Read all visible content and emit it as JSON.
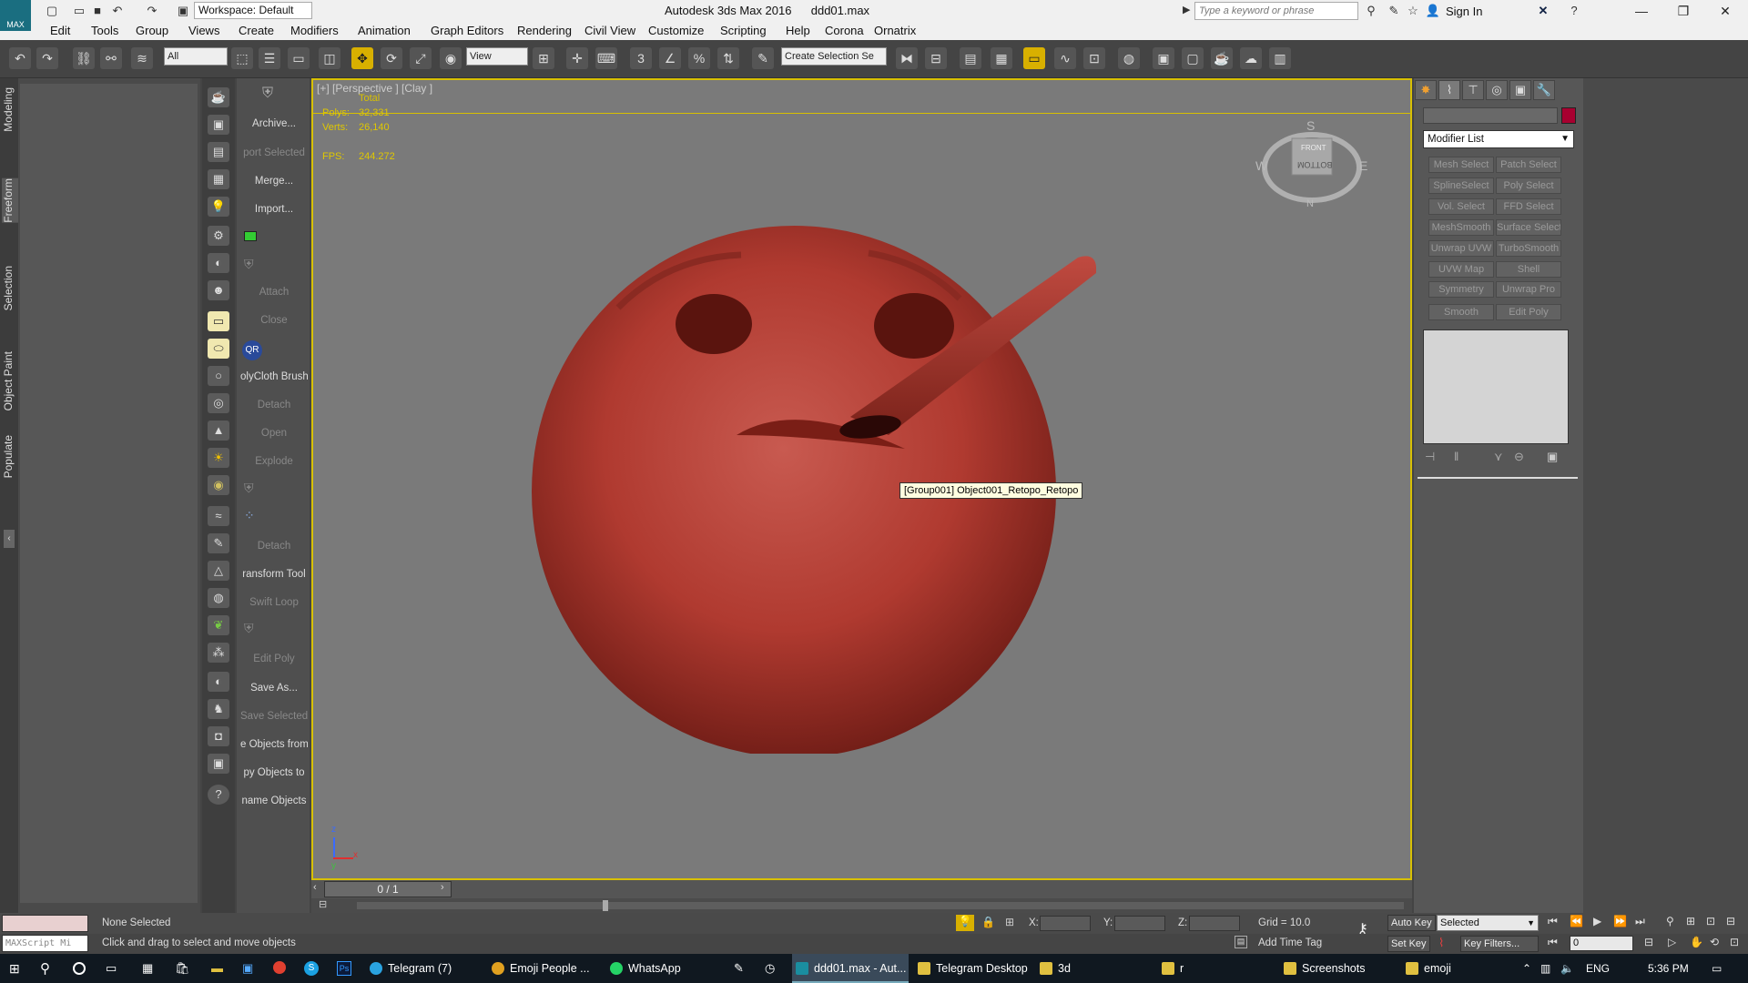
{
  "app": {
    "title": "Autodesk 3ds Max 2016",
    "file": "ddd01.max",
    "logo_text": "MAX",
    "workspace": "Workspace: Default",
    "search_placeholder": "Type a keyword or phrase",
    "sign_in": "Sign In"
  },
  "menubar": [
    "Edit",
    "Tools",
    "Group",
    "Views",
    "Create",
    "Modifiers",
    "Animation",
    "Graph Editors",
    "Rendering",
    "Civil View",
    "Customize",
    "Scripting",
    "Help",
    "Corona",
    "Ornatrix"
  ],
  "toolbar": {
    "filter": "All",
    "view_dropdown": "View",
    "selection_set": "Create Selection Se"
  },
  "side_tabs": [
    "Modeling",
    "Freeform",
    "Selection",
    "Object Paint",
    "Populate"
  ],
  "script_panel": [
    {
      "label": "Archive...",
      "dim": false
    },
    {
      "label": "port Selected",
      "dim": true
    },
    {
      "label": "Merge...",
      "dim": false
    },
    {
      "label": "Import...",
      "dim": false
    },
    {
      "label": "Attach",
      "dim": true
    },
    {
      "label": "Close",
      "dim": true
    },
    {
      "label": "olyCloth Brush",
      "dim": false
    },
    {
      "label": "Detach",
      "dim": true
    },
    {
      "label": "Open",
      "dim": true
    },
    {
      "label": "Explode",
      "dim": true
    },
    {
      "label": "Detach",
      "dim": true
    },
    {
      "label": "ransform Tool",
      "dim": false
    },
    {
      "label": "Swift Loop",
      "dim": true
    },
    {
      "label": "Edit Poly",
      "dim": true
    },
    {
      "label": "Save As...",
      "dim": false
    },
    {
      "label": "Save Selected",
      "dim": true
    },
    {
      "label": "e Objects from",
      "dim": false
    },
    {
      "label": "py Objects to",
      "dim": false
    },
    {
      "label": "name Objects",
      "dim": false
    }
  ],
  "viewport": {
    "label": "[+] [Perspective ] [Clay ]",
    "stats_header": "Total",
    "polys_label": "Polys:",
    "polys": "32,331",
    "verts_label": "Verts:",
    "verts": "26,140",
    "fps_label": "FPS:",
    "fps": "244.272",
    "tooltip": "[Group001] Object001_Retopo_Retopo",
    "viewcube_face": "BOTTOM",
    "viewcube_front": "FRONT",
    "compass": {
      "n": "N",
      "s": "S",
      "e": "E",
      "w": "W"
    },
    "axis": {
      "z": "z",
      "x": "x",
      "y": "y"
    }
  },
  "timeline": {
    "frame": "0 / 1"
  },
  "command_panel": {
    "modifier_list": "Modifier List",
    "modifiers": [
      "Mesh Select",
      "Patch Select",
      "SplineSelect",
      "Poly Select",
      "Vol. Select",
      "FFD Select",
      "MeshSmooth",
      "Surface Select",
      "Unwrap UVW",
      "TurboSmooth",
      "UVW Map",
      "Shell",
      "Symmetry",
      "Unwrap Pro",
      "Smooth",
      "Edit Poly"
    ],
    "object_color": "#a80030"
  },
  "status": {
    "maxscript": "MAXScript Mi",
    "selection": "None Selected",
    "prompt": "Click and drag to select and move objects",
    "x_label": "X:",
    "y_label": "Y:",
    "z_label": "Z:",
    "grid": "Grid = 10.0",
    "add_time_tag": "Add Time Tag",
    "auto_key": "Auto Key",
    "set_key": "Set Key",
    "selected_dd": "Selected",
    "key_filters": "Key Filters...",
    "frame_input": "0"
  },
  "taskbar": {
    "items": [
      {
        "label": "Telegram (7)",
        "color": "#2aa3e0",
        "active": false
      },
      {
        "label": "Emoji People ...",
        "color": "#e0a020",
        "active": false
      },
      {
        "label": "WhatsApp",
        "color": "#25d366",
        "active": false
      },
      {
        "label": "ddd01.max - Aut...",
        "color": "#1a8ea0",
        "active": true
      },
      {
        "label": "Telegram Desktop",
        "color": "#e0c040",
        "active": false
      },
      {
        "label": "3d",
        "color": "#e0c040",
        "active": false
      },
      {
        "label": "r",
        "color": "#e0c040",
        "active": false
      },
      {
        "label": "Screenshots",
        "color": "#e0c040",
        "active": false
      },
      {
        "label": "emoji",
        "color": "#e0c040",
        "active": false
      }
    ],
    "lang": "ENG",
    "time": "5:36 PM"
  }
}
